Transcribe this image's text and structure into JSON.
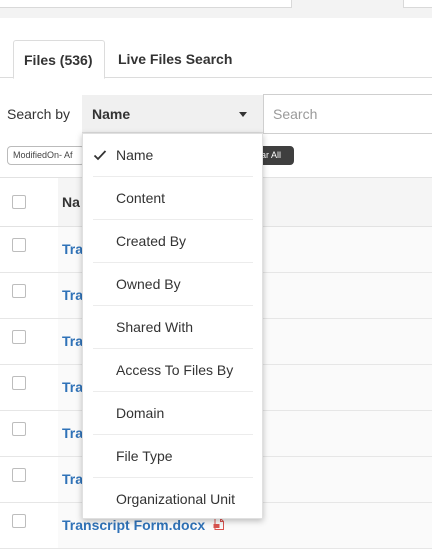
{
  "tabs": [
    {
      "label": "Files (536)",
      "active": true
    },
    {
      "label": "Live Files Search",
      "active": false
    }
  ],
  "search": {
    "by_label": "Search by",
    "selected": "Name",
    "placeholder": "Search"
  },
  "chips": {
    "filter_label": "ModifiedOn- Af",
    "clear_label": "ear All"
  },
  "table": {
    "header_name": "Na",
    "rows": [
      {
        "name": "Tra"
      },
      {
        "name": "Tra"
      },
      {
        "name": "Tra"
      },
      {
        "name": "Tra"
      },
      {
        "name": "Tra"
      },
      {
        "name": "Tra"
      },
      {
        "name": "Transcript Form.docx"
      }
    ]
  },
  "dropdown": {
    "options": [
      {
        "label": "Name",
        "checked": true
      },
      {
        "label": "Content",
        "checked": false
      },
      {
        "label": "Created By",
        "checked": false
      },
      {
        "label": "Owned By",
        "checked": false
      },
      {
        "label": "Shared With",
        "checked": false
      },
      {
        "label": "Access To Files By",
        "checked": false
      },
      {
        "label": "Domain",
        "checked": false
      },
      {
        "label": "File Type",
        "checked": false
      },
      {
        "label": "Organizational Unit",
        "checked": false
      }
    ]
  },
  "colors": {
    "link": "#2f72b8",
    "chip_dark": "#3f3f3f",
    "file_icon": "#d9534f"
  },
  "icons": {
    "caret": "chevron-down-icon",
    "check": "check-icon",
    "file": "document-file-icon"
  }
}
